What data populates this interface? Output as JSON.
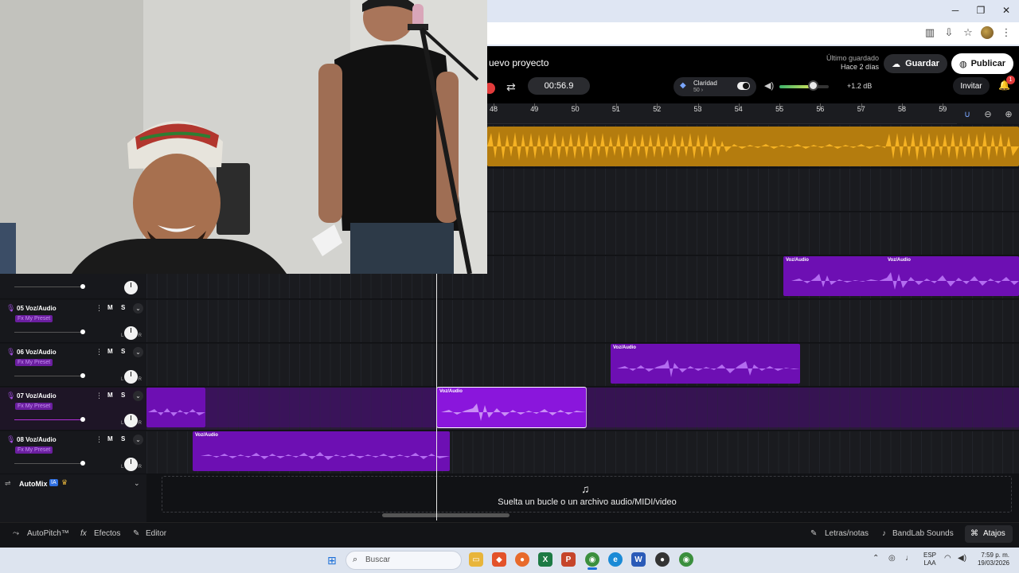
{
  "header": {
    "project_title": "uevo proyecto",
    "saved_label": "Último guardado",
    "saved_value": "Hace 2 días",
    "save_button": "Guardar",
    "publish_button": "Publicar"
  },
  "transport": {
    "time": "00:56.9",
    "clarity_label": "Claridad",
    "clarity_value": "50 ›",
    "master_volume_level": 0.7,
    "gain": "+1.2 dB",
    "invite": "Invitar",
    "notifications": "1"
  },
  "ruler": {
    "bars": [
      "48",
      "49",
      "50",
      "51",
      "52",
      "53",
      "54",
      "55",
      "56",
      "57",
      "58",
      "59"
    ]
  },
  "tracks": [
    {
      "number": "05",
      "name": "Voz/Audio",
      "preset": "Fx My Preset",
      "m": "M",
      "s": "S",
      "pan_l": "L",
      "pan_r": "R"
    },
    {
      "number": "06",
      "name": "Voz/Audio",
      "preset": "Fx My Preset",
      "m": "M",
      "s": "S",
      "pan_l": "L",
      "pan_r": "R"
    },
    {
      "number": "07",
      "name": "Voz/Audio",
      "preset": "Fx My Preset",
      "m": "M",
      "s": "S",
      "pan_l": "L",
      "pan_r": "R"
    },
    {
      "number": "08",
      "name": "Voz/Audio",
      "preset": "Fx My Preset",
      "m": "M",
      "s": "S",
      "pan_l": "L",
      "pan_r": "R"
    }
  ],
  "clips": {
    "label": "Voz/Audio"
  },
  "automix": {
    "label": "AutoMix",
    "badge": "IA"
  },
  "drop_zone": {
    "text": "Suelta un bucle o un archivo audio/MIDI/video"
  },
  "bottom_bar": {
    "autopitch": "AutoPitch™",
    "effects": "Efectos",
    "editor": "Editor",
    "lyrics": "Letras/notas",
    "sounds": "BandLab Sounds",
    "shortcuts": "Atajos"
  },
  "taskbar": {
    "search": "Buscar",
    "lang1": "ESP",
    "lang2": "LAA",
    "time": "7:59 p. m.",
    "date": "19/03/2026"
  },
  "colors": {
    "accent_purple": "#6d0fb3",
    "accent_yellow": "#f5b223",
    "record_red": "#e23b3b"
  }
}
